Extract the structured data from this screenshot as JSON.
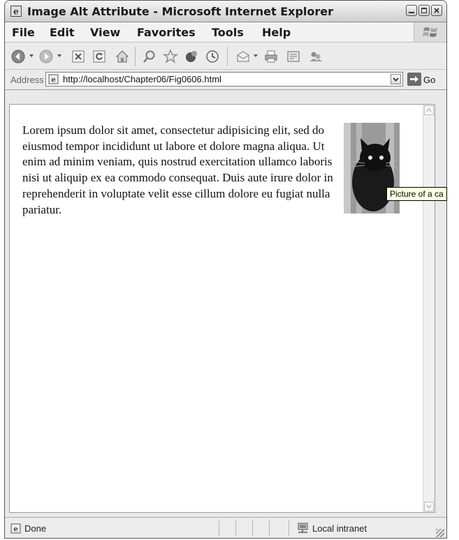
{
  "window": {
    "title": "Image Alt Attribute - Microsoft Internet Explorer"
  },
  "menu": {
    "items": [
      "File",
      "Edit",
      "View",
      "Favorites",
      "Tools",
      "Help"
    ]
  },
  "toolbar": {
    "icons": [
      "back-icon",
      "forward-icon",
      "stop-icon",
      "refresh-icon",
      "home-icon",
      "search-icon",
      "favorites-icon",
      "media-icon",
      "history-icon",
      "mail-icon",
      "print-icon",
      "edit-icon",
      "messenger-icon"
    ]
  },
  "address": {
    "label": "Address",
    "url": "http://localhost/Chapter06/Fig0606.html",
    "go_label": "Go"
  },
  "content": {
    "paragraph": "Lorem ipsum dolor sit amet, consectetur adipisicing elit, sed do eiusmod tempor incididunt ut labore et dolore magna aliqua. Ut enim ad minim veniam, quis nostrud exercitation ullamco laboris nisi ut aliquip ex ea commodo consequat. Duis aute irure dolor in reprehenderit in voluptate velit esse cillum dolore eu fugiat nulla pariatur.",
    "image_alt": "Picture of a cat",
    "tooltip": "Picture of a ca"
  },
  "status": {
    "text": "Done",
    "zone": "Local intranet"
  }
}
